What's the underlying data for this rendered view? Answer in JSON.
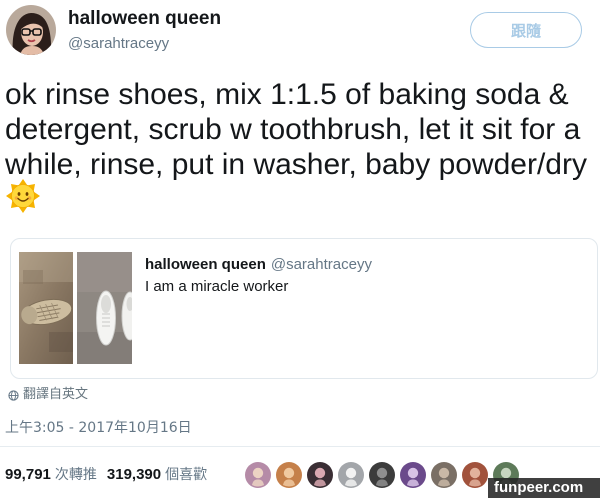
{
  "header": {
    "display_name": "halloween queen",
    "handle": "@sarahtraceyy",
    "follow_label": "跟隨"
  },
  "tweet": {
    "text": "ok rinse shoes, mix 1:1.5 of baking soda & detergent, scrub w toothbrush, let it sit for a while, rinse, put in washer, baby powder/dry",
    "emoji_icon": "sun-with-face-icon"
  },
  "quoted_tweet": {
    "display_name": "halloween queen",
    "handle": "@sarahtraceyy",
    "text": "I am a miracle worker"
  },
  "translate": {
    "icon": "globe-icon",
    "label": "翻譯自英文"
  },
  "timestamp": "上午3:05 - 2017年10月16日",
  "stats": {
    "retweets_count": "99,791",
    "retweets_label": "次轉推",
    "likes_count": "319,390",
    "likes_label": "個喜歡"
  },
  "likers": [
    {
      "bg": "#b58ba7",
      "face": "#ecd3c3"
    },
    {
      "bg": "#c5804a",
      "face": "#f0c9a0"
    },
    {
      "bg": "#3a2e34",
      "face": "#d9a7b0"
    },
    {
      "bg": "#a3a6aa",
      "face": "#f2f2f2"
    },
    {
      "bg": "#3c3c3c",
      "face": "#8e8e8e"
    },
    {
      "bg": "#6b4a8b",
      "face": "#d8c3e6"
    },
    {
      "bg": "#7a6f65",
      "face": "#c9b8a6"
    },
    {
      "bg": "#a1523c",
      "face": "#e2b29c"
    },
    {
      "bg": "#5d7a59",
      "face": "#c7d6c0"
    }
  ],
  "colors": {
    "follow_accent": "#a9cbe6"
  },
  "watermark": "funpeer.com"
}
